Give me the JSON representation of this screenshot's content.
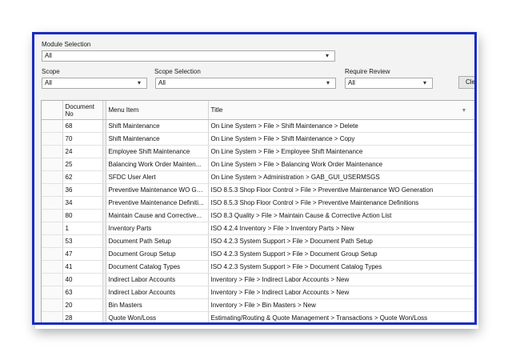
{
  "filters": {
    "module_label": "Module Selection",
    "module_value": "All",
    "scope_label": "Scope",
    "scope_value": "All",
    "scope_selection_label": "Scope Selection",
    "scope_selection_value": "All",
    "require_review_label": "Require Review",
    "require_review_value": "All",
    "clear_button": "Cle"
  },
  "icons": {
    "dropdown": "chevron-down-icon",
    "sort": "sort-desc-icon"
  },
  "colors": {
    "frame_border": "#1b2bbf"
  },
  "table": {
    "columns": {
      "doc_no": "Document No",
      "menu_item": "Menu Item",
      "title": "Title"
    },
    "rows": [
      {
        "doc_no": "68",
        "menu_item": "Shift Maintenance",
        "title": "On Line System > File > Shift Maintenance > Delete"
      },
      {
        "doc_no": "70",
        "menu_item": "Shift Maintenance",
        "title": "On Line System > File > Shift Maintenance > Copy"
      },
      {
        "doc_no": "24",
        "menu_item": "Employee Shift Maintenance",
        "title": "On Line System > File > Employee Shift Maintenance"
      },
      {
        "doc_no": "25",
        "menu_item": "Balancing Work Order Mainten...",
        "title": "On Line System > File > Balancing Work Order Maintenance"
      },
      {
        "doc_no": "62",
        "menu_item": "SFDC User Alert",
        "title": "On Line System > Administration > GAB_GUI_USERMSGS"
      },
      {
        "doc_no": "36",
        "menu_item": "Preventive Maintenance WO Ge...",
        "title": "ISO 8.5.3 Shop Floor Control > File > Preventive Maintenance WO Generation"
      },
      {
        "doc_no": "34",
        "menu_item": "Preventive Maintenance Definiti...",
        "title": "ISO 8.5.3 Shop Floor Control > File > Preventive Maintenance Definitions"
      },
      {
        "doc_no": "80",
        "menu_item": "Maintain Cause  and  Corrective...",
        "title": "ISO 8.3 Quality > File > Maintain Cause & Corrective Action List"
      },
      {
        "doc_no": "1",
        "menu_item": "Inventory Parts",
        "title": "ISO 4.2.4 Inventory > File > Inventory Parts > New"
      },
      {
        "doc_no": "53",
        "menu_item": "Document Path Setup",
        "title": "ISO 4.2.3 System Support > File > Document Path Setup"
      },
      {
        "doc_no": "47",
        "menu_item": "Document Group Setup",
        "title": "ISO 4.2.3 System Support > File > Document Group Setup"
      },
      {
        "doc_no": "41",
        "menu_item": "Document Catalog Types",
        "title": "ISO 4.2.3 System Support > File > Document Catalog Types"
      },
      {
        "doc_no": "40",
        "menu_item": "Indirect Labor Accounts",
        "title": "Inventory > File > Indirect Labor Accounts > New"
      },
      {
        "doc_no": "63",
        "menu_item": "Indirect Labor Accounts",
        "title": "Inventory > File > Indirect Labor Accounts > New"
      },
      {
        "doc_no": "20",
        "menu_item": "Bin Masters",
        "title": "Inventory > File > Bin Masters > New"
      },
      {
        "doc_no": "28",
        "menu_item": "Quote Won/Loss",
        "title": "Estimating/Routing & Quote Management > Transactions > Quote Won/Loss"
      }
    ]
  }
}
